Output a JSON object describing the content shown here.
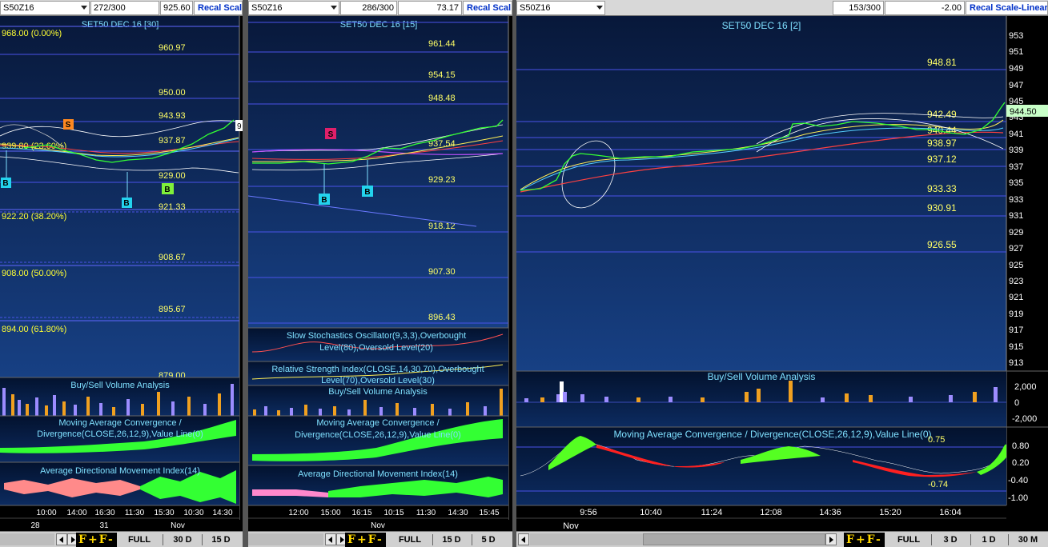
{
  "panels": [
    {
      "symbol": "S50Z16",
      "count": "272/300",
      "price": "925.60",
      "recal": "Recal Scale",
      "chart_title": "SET50 DEC 16  [30]",
      "fib_labels": [
        "968.00 (0.00%)",
        "939.80 (23.60%)",
        "922.20 (38.20%)",
        "908.00 (50.00%)",
        "894.00 (61.80%)"
      ],
      "level_labels": [
        "960.97",
        "950.00",
        "943.93",
        "937.87",
        "929.00",
        "921.33",
        "908.67",
        "895.67",
        "879.00"
      ],
      "signals": [
        "S",
        "B",
        "B",
        "B"
      ],
      "price_tag": "9",
      "indicators": [
        "Buy/Sell Volume Analysis",
        "Moving Average Convergence / Divergence(CLOSE,26,12,9),Value Line(0)",
        "Average Directional Movement Index(14)"
      ],
      "time_labels": [
        "10:00",
        "14:00",
        "16:30",
        "11:30",
        "15:30",
        "10:30",
        "14:30"
      ],
      "date_labels": [
        "28",
        "31",
        "Nov"
      ],
      "periods": [
        "FULL",
        "30 D",
        "15 D"
      ]
    },
    {
      "symbol": "S50Z16",
      "count": "286/300",
      "price": "73.17",
      "recal": "Recal Scal",
      "chart_title": "SET50 DEC 16  [15]",
      "level_labels": [
        "961.44",
        "954.15",
        "948.48",
        "937.54",
        "929.23",
        "918.12",
        "907.30",
        "896.43"
      ],
      "signals": [
        "S",
        "B",
        "B"
      ],
      "indicators": [
        "Slow Stochastics Oscillator(9,3,3),Overbought Level(80),Oversold Level(20)",
        "Relative Strength Index(CLOSE,14,30,70),Overbought Level(70),Oversold Level(30)",
        "Buy/Sell Volume Analysis",
        "Moving Average Convergence / Divergence(CLOSE,26,12,9),Value Line(0)",
        "Average Directional Movement Index(14)"
      ],
      "time_labels": [
        "12:00",
        "15:00",
        "16:15",
        "10:15",
        "11:30",
        "14:30",
        "15:45"
      ],
      "date_labels": [
        "Nov"
      ],
      "periods": [
        "FULL",
        "15 D",
        "5 D"
      ]
    },
    {
      "symbol": "S50Z16",
      "count": "153/300",
      "price": "-2.00",
      "recal": "Recal Scale-Linear",
      "chart_title": "SET50 DEC 16  [2]",
      "level_labels": [
        "948.81",
        "942.49",
        "940.44",
        "938.97",
        "937.12",
        "933.33",
        "930.91",
        "926.55"
      ],
      "axis_labels": [
        "953",
        "951",
        "949",
        "947",
        "945",
        "943",
        "941",
        "939",
        "937",
        "935",
        "933",
        "931",
        "929",
        "927",
        "925",
        "923",
        "921",
        "919",
        "917",
        "915",
        "913"
      ],
      "price_tag": "944.50",
      "indicators": [
        "Buy/Sell Volume Analysis",
        "Moving Average Convergence / Divergence(CLOSE,26,12,9),Value Line(0)"
      ],
      "volume_axis": [
        "2,000",
        "0",
        "-2,000"
      ],
      "macd_axis": [
        "0.80",
        "0.20",
        "-0.40",
        "-1.00"
      ],
      "macd_levels": [
        "0.75",
        "-0.74"
      ],
      "time_labels": [
        "9:56",
        "10:40",
        "11:24",
        "12:08",
        "14:36",
        "15:20",
        "16:04"
      ],
      "date_labels": [
        "Nov"
      ],
      "periods": [
        "FULL",
        "3 D",
        "1 D",
        "30 M"
      ]
    }
  ],
  "fplus_label": "F+",
  "fminus_label": "F-",
  "colors": {
    "background": "#000000",
    "chart_bg_top": "#0a1b3c",
    "chart_bg_bottom": "#163a78",
    "level_line": "#5f67ff",
    "level_label": "#ffff66",
    "title_text": "#7fe0ff",
    "fib_label": "#ffff33",
    "volume_buy": "#f0a020",
    "volume_sell": "#9c8cff"
  }
}
